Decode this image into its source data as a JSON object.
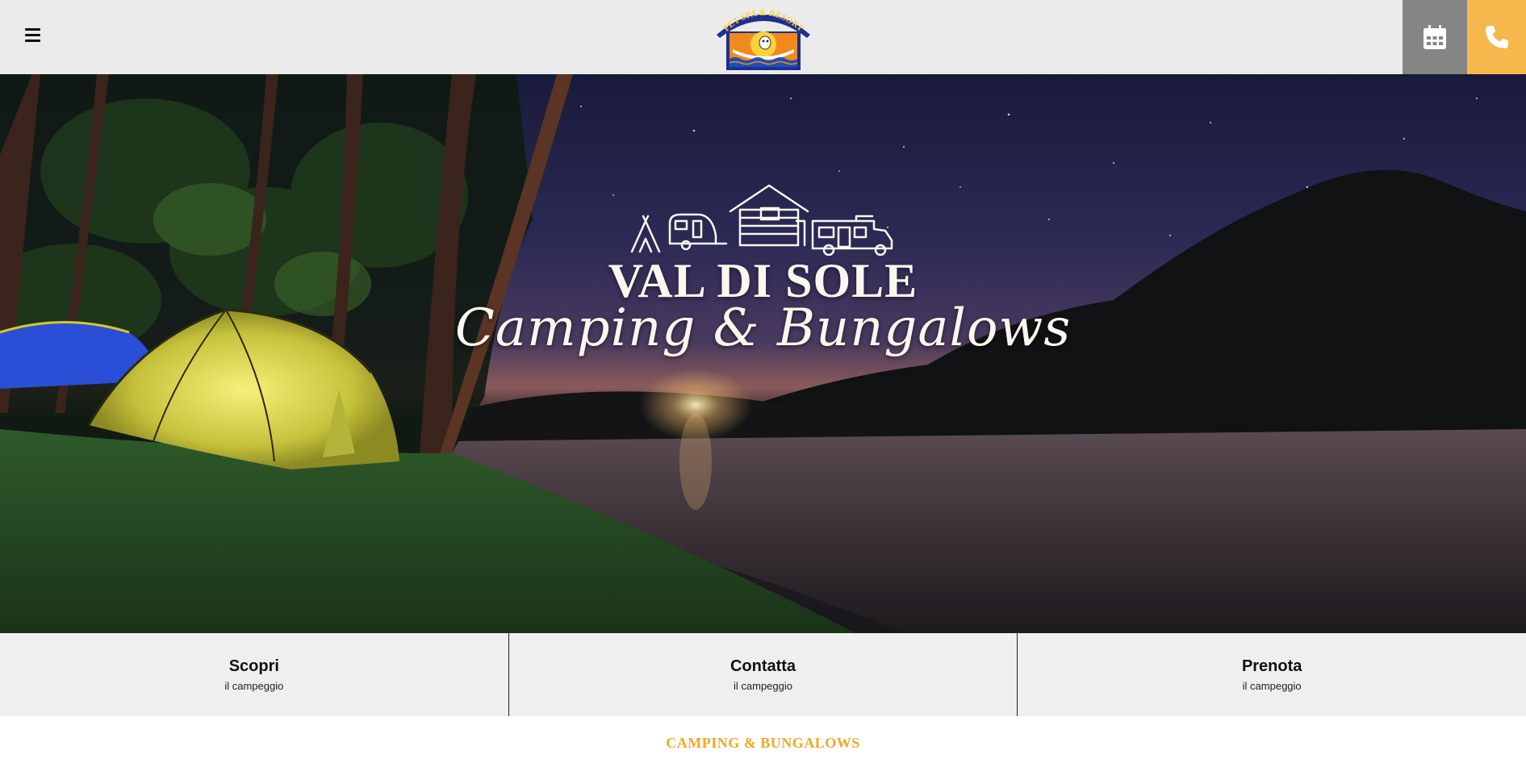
{
  "header": {
    "menu_icon": "hamburger-menu-icon",
    "logo": {
      "icon": "pet-spa-resort-logo",
      "text": "PET SPA & RESORT"
    },
    "calendar_button": {
      "icon": "calendar-icon"
    },
    "phone_button": {
      "icon": "phone-icon"
    }
  },
  "hero": {
    "icons": [
      "tent-icon",
      "caravan-icon",
      "bungalow-icon",
      "camper-icon"
    ],
    "title": "VAL DI SOLE",
    "subtitle": "Camping & Bungalows"
  },
  "quick_links": [
    {
      "title": "Scopri",
      "subtitle": "il campeggio"
    },
    {
      "title": "Contatta",
      "subtitle": "il campeggio"
    },
    {
      "title": "Prenota",
      "subtitle": "il campeggio"
    }
  ],
  "section": {
    "heading": "CAMPING & BUNGALOWS"
  },
  "colors": {
    "accent": "#f6b84c",
    "heading": "#f5a623",
    "header_bg": "#ebebeb",
    "calendar_bg": "#858585",
    "quicklinks_bg": "#efefef"
  }
}
